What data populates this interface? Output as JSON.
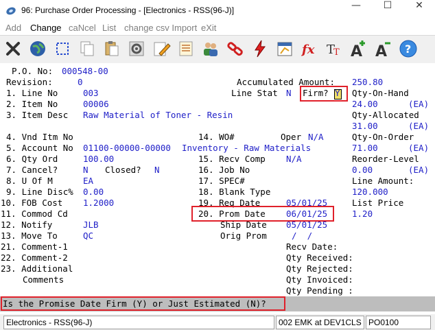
{
  "window": {
    "title": "96: Purchase Order Processing - [Electronics - RSS(96-J)]"
  },
  "menu": [
    "Add",
    "Change",
    "caNcel",
    "List",
    "change csv Import",
    "eXit"
  ],
  "po": {
    "po_no_label": "P.O. No:",
    "po_no": "000548-00",
    "revision_label": "Revision:",
    "revision": "0",
    "accum_label": "Accumulated Amount:",
    "accum": "250.80",
    "line_no_label": "1. Line No",
    "line_no": "003",
    "line_stat_label": "Line Stat",
    "line_stat": "N",
    "firm_label": "Firm?",
    "firm": "Y",
    "item_no_label": "2. Item No",
    "item_no": "00006",
    "item_desc_label": "3. Item Desc",
    "item_desc": "Raw Material of Toner - Resin",
    "vnd_itm_label": "4. Vnd Itm No",
    "acct_label": "5. Account No",
    "acct": "01100-00000-00000",
    "acct_desc": "Inventory - Raw Materials",
    "qty_ord_label": "6. Qty Ord",
    "qty_ord": "100.00",
    "cancel_label": "7. Cancel?",
    "cancel": "N",
    "closed_label": "Closed?",
    "closed": "N",
    "uom_label": "8. U Of M",
    "uom": "EA",
    "disc_label": "9. Line Disc%",
    "disc": "0.00",
    "fob_label": "10. FOB Cost",
    "fob": "1.2000",
    "commod_label": "11. Commod Cd",
    "notify_label": "12. Notify",
    "notify": "JLB",
    "move_label": "13. Move To",
    "move": "QC",
    "c1_label": "21. Comment-1",
    "c2_label": "22. Comment-2",
    "add_label": "23. Additional",
    "comments_label": "Comments",
    "wo_label": "14. WO#",
    "oper_label": "Oper",
    "oper": "N/A",
    "recv_comp_label": "15. Recv Comp",
    "recv_comp": "N/A",
    "job_label": "16. Job No",
    "spec_label": "17. SPEC#",
    "blank_label": "18. Blank Type",
    "req_label": "19. Req Date",
    "req": "05/01/25",
    "prom_label": "20. Prom Date",
    "prom": "06/01/25",
    "ship_label": "Ship Date",
    "ship": "05/01/25",
    "orig_label": "Orig Prom",
    "orig": "/  /",
    "recv_date_label": "Recv Date:",
    "qty_recv_label": "Qty Received:",
    "qty_rej_label": "Qty Rejected:",
    "qty_inv_label": "Qty Invoiced:",
    "qty_pend_label": "Qty Pending :",
    "onhand_label": "Qty-On-Hand",
    "onhand": "24.00",
    "onhand_uom": "(EA)",
    "alloc_label": "Qty-Allocated",
    "alloc": "31.00",
    "alloc_uom": "(EA)",
    "onorder_label": "Qty-On-Order",
    "onorder": "71.00",
    "onorder_uom": "(EA)",
    "reorder_label": "Reorder-Level",
    "reorder": "0.00",
    "reorder_uom": "(EA)",
    "line_amt_label": "Line Amount:",
    "line_amt": "120.000",
    "list_price_label": "List Price",
    "list_price": "1.20"
  },
  "prompt": "Is the Promise Date Firm (Y) or Just Estimated (N)?",
  "status": [
    "Electronics - RSS(96-J)",
    "002 EMK at DEV1CLS",
    "PO0100"
  ],
  "icons": [
    "exit-icon",
    "globe-icon",
    "select-icon",
    "copy-icon",
    "paste-icon",
    "settings-icon",
    "edit-icon",
    "notes-icon",
    "users-icon",
    "link-icon",
    "lightning-icon",
    "calendar-icon",
    "function-icon",
    "text-format-icon",
    "font-larger-icon",
    "font-smaller-icon",
    "help-icon"
  ],
  "colors": {
    "value": "#2020c8",
    "highlight": "#e0202a",
    "prompt_bg": "#bdbdbd"
  }
}
